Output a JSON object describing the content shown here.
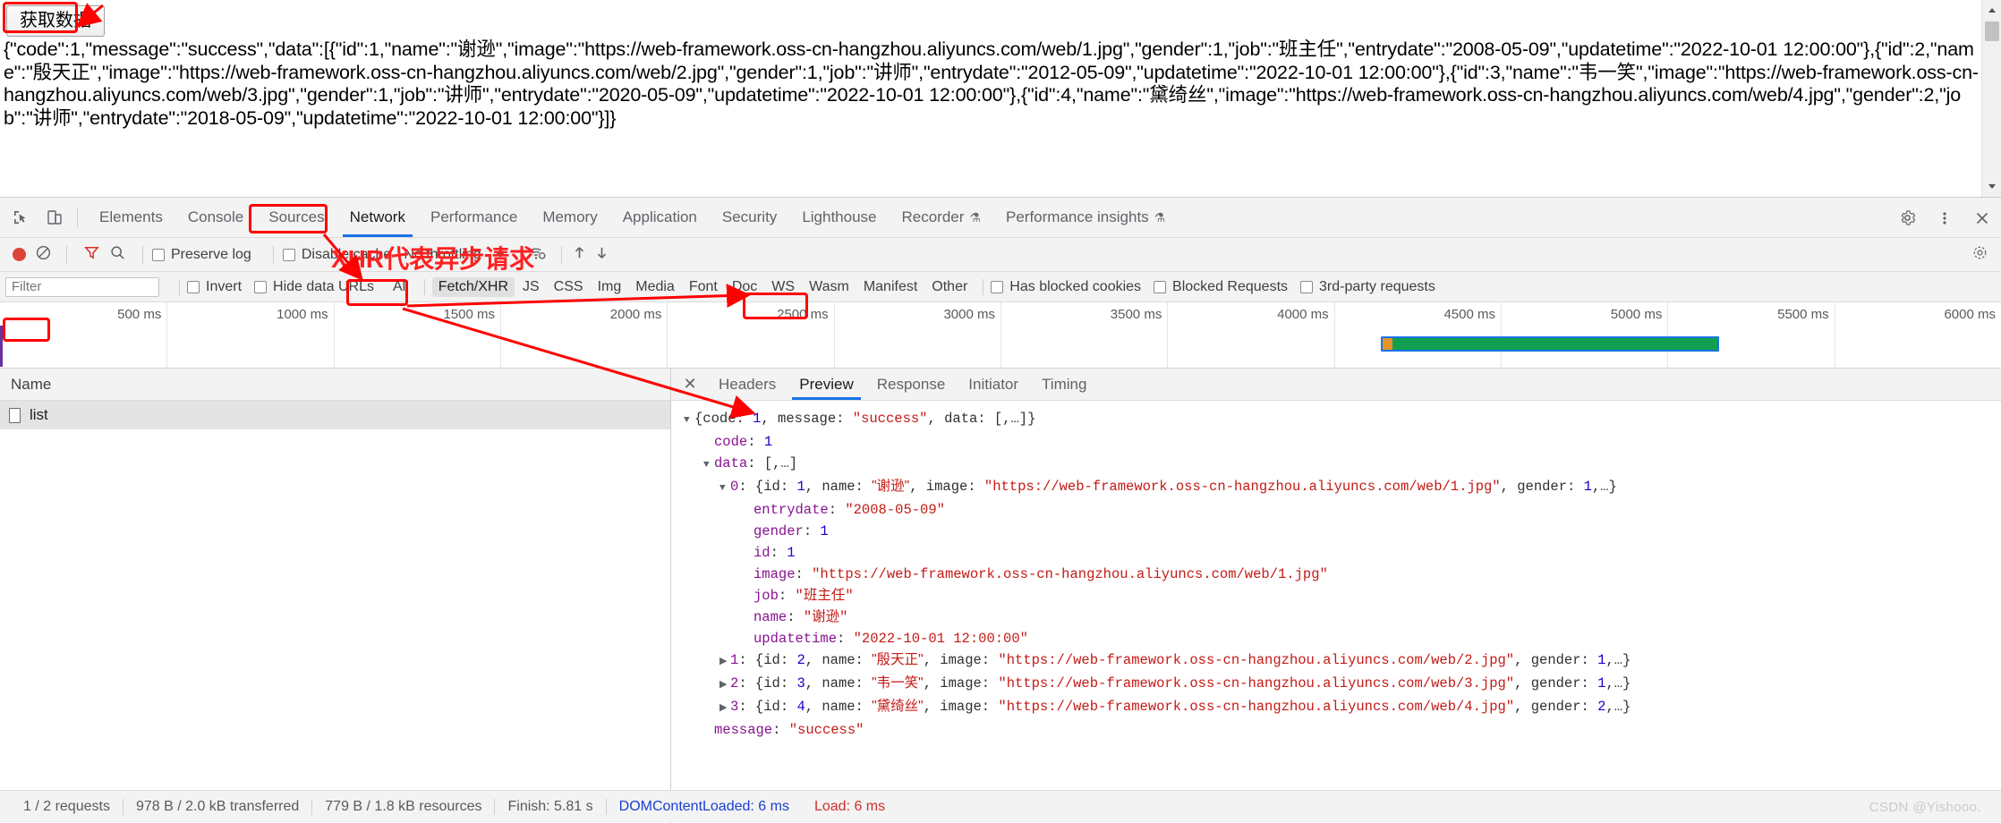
{
  "page": {
    "button_label": "获取数据",
    "json_dump": "{\"code\":1,\"message\":\"success\",\"data\":[{\"id\":1,\"name\":\"谢逊\",\"image\":\"https://web-framework.oss-cn-hangzhou.aliyuncs.com/web/1.jpg\",\"gender\":1,\"job\":\"班主任\",\"entrydate\":\"2008-05-09\",\"updatetime\":\"2022-10-01 12:00:00\"},{\"id\":2,\"name\":\"殷天正\",\"image\":\"https://web-framework.oss-cn-hangzhou.aliyuncs.com/web/2.jpg\",\"gender\":1,\"job\":\"讲师\",\"entrydate\":\"2012-05-09\",\"updatetime\":\"2022-10-01 12:00:00\"},{\"id\":3,\"name\":\"韦一笑\",\"image\":\"https://web-framework.oss-cn-hangzhou.aliyuncs.com/web/3.jpg\",\"gender\":1,\"job\":\"讲师\",\"entrydate\":\"2020-05-09\",\"updatetime\":\"2022-10-01 12:00:00\"},{\"id\":4,\"name\":\"黛绮丝\",\"image\":\"https://web-framework.oss-cn-hangzhou.aliyuncs.com/web/4.jpg\",\"gender\":2,\"job\":\"讲师\",\"entrydate\":\"2018-05-09\",\"updatetime\":\"2022-10-01 12:00:00\"}]}"
  },
  "devtools": {
    "tabs": [
      {
        "label": "Elements",
        "active": false,
        "flask": false
      },
      {
        "label": "Console",
        "active": false,
        "flask": false
      },
      {
        "label": "Sources",
        "active": false,
        "flask": false
      },
      {
        "label": "Network",
        "active": true,
        "flask": false
      },
      {
        "label": "Performance",
        "active": false,
        "flask": false
      },
      {
        "label": "Memory",
        "active": false,
        "flask": false
      },
      {
        "label": "Application",
        "active": false,
        "flask": false
      },
      {
        "label": "Security",
        "active": false,
        "flask": false
      },
      {
        "label": "Lighthouse",
        "active": false,
        "flask": false
      },
      {
        "label": "Recorder",
        "active": false,
        "flask": true
      },
      {
        "label": "Performance insights",
        "active": false,
        "flask": true
      }
    ],
    "icons": {
      "inspect": "inspect-element-icon",
      "device": "device-toolbar-icon",
      "settings": "gear-icon",
      "more": "kebab-menu-icon",
      "close": "close-icon",
      "record": "record-icon",
      "clear": "clear-icon",
      "filter": "filter-icon",
      "search": "search-icon",
      "wifi": "network-conditions-icon",
      "import": "import-har-icon",
      "export": "export-har-icon"
    },
    "controls": {
      "preserve_log": "Preserve log",
      "disable_cache": "Disable cache",
      "throttling": "No throttling"
    },
    "filterbar": {
      "filter_placeholder": "Filter",
      "filter_value": "",
      "invert": "Invert",
      "hide_data_urls": "Hide data URLs",
      "types": [
        {
          "label": "All",
          "active": false
        },
        {
          "label": "Fetch/XHR",
          "active": true
        },
        {
          "label": "JS",
          "active": false
        },
        {
          "label": "CSS",
          "active": false
        },
        {
          "label": "Img",
          "active": false
        },
        {
          "label": "Media",
          "active": false
        },
        {
          "label": "Font",
          "active": false
        },
        {
          "label": "Doc",
          "active": false
        },
        {
          "label": "WS",
          "active": false
        },
        {
          "label": "Wasm",
          "active": false
        },
        {
          "label": "Manifest",
          "active": false
        },
        {
          "label": "Other",
          "active": false
        }
      ],
      "has_blocked_cookies": "Has blocked cookies",
      "blocked_requests": "Blocked Requests",
      "third_party_requests": "3rd-party requests"
    },
    "overview": {
      "ticks": [
        "500 ms",
        "1000 ms",
        "1500 ms",
        "2000 ms",
        "2500 ms",
        "3000 ms",
        "3500 ms",
        "4000 ms",
        "4500 ms",
        "5000 ms",
        "5500 ms",
        "6000 ms"
      ]
    },
    "requests": {
      "column_name": "Name",
      "rows": [
        {
          "name": "list"
        }
      ]
    },
    "detail_tabs": [
      {
        "label": "Headers",
        "active": false
      },
      {
        "label": "Preview",
        "active": true
      },
      {
        "label": "Response",
        "active": false
      },
      {
        "label": "Initiator",
        "active": false
      },
      {
        "label": "Timing",
        "active": false
      }
    ],
    "preview_tree": [
      {
        "indent": 0,
        "tri": "▼",
        "text": "{code: 1, message: \"success\", data: [,…]}",
        "style": "plain"
      },
      {
        "indent": 1,
        "tri": "",
        "key": "code",
        "val": "1",
        "valtype": "num"
      },
      {
        "indent": 0,
        "tri": "▼",
        "key": "data",
        "val": "[,…]",
        "valtype": "plain",
        "indentpx": 22
      },
      {
        "indent": 0,
        "tri": "▼",
        "key": "0",
        "val": "{id: 1, name: \"谢逊\", image: \"https://web-framework.oss-cn-hangzhou.aliyuncs.com/web/1.jpg\", gender: 1,…}",
        "valtype": "object",
        "indentpx": 40
      },
      {
        "indent": 0,
        "tri": "",
        "key": "entrydate",
        "val": "\"2008-05-09\"",
        "valtype": "str",
        "indentpx": 66
      },
      {
        "indent": 0,
        "tri": "",
        "key": "gender",
        "val": "1",
        "valtype": "num",
        "indentpx": 66
      },
      {
        "indent": 0,
        "tri": "",
        "key": "id",
        "val": "1",
        "valtype": "num",
        "indentpx": 66
      },
      {
        "indent": 0,
        "tri": "",
        "key": "image",
        "val": "\"https://web-framework.oss-cn-hangzhou.aliyuncs.com/web/1.jpg\"",
        "valtype": "str",
        "indentpx": 66
      },
      {
        "indent": 0,
        "tri": "",
        "key": "job",
        "val": "\"班主任\"",
        "valtype": "str",
        "indentpx": 66
      },
      {
        "indent": 0,
        "tri": "",
        "key": "name",
        "val": "\"谢逊\"",
        "valtype": "str",
        "indentpx": 66
      },
      {
        "indent": 0,
        "tri": "",
        "key": "updatetime",
        "val": "\"2022-10-01 12:00:00\"",
        "valtype": "str",
        "indentpx": 66
      },
      {
        "indent": 0,
        "tri": "▶",
        "key": "1",
        "val": "{id: 2, name: \"殷天正\", image: \"https://web-framework.oss-cn-hangzhou.aliyuncs.com/web/2.jpg\", gender: 1,…}",
        "valtype": "object",
        "indentpx": 40
      },
      {
        "indent": 0,
        "tri": "▶",
        "key": "2",
        "val": "{id: 3, name: \"韦一笑\", image: \"https://web-framework.oss-cn-hangzhou.aliyuncs.com/web/3.jpg\", gender: 1,…}",
        "valtype": "object",
        "indentpx": 40
      },
      {
        "indent": 0,
        "tri": "▶",
        "key": "3",
        "val": "{id: 4, name: \"黛绮丝\", image: \"https://web-framework.oss-cn-hangzhou.aliyuncs.com/web/4.jpg\", gender: 2,…}",
        "valtype": "object",
        "indentpx": 40
      },
      {
        "indent": 0,
        "tri": "",
        "key": "message",
        "val": "\"success\"",
        "valtype": "str",
        "indentpx": 22
      }
    ],
    "status": {
      "requests": "1 / 2 requests",
      "transferred": "978 B / 2.0 kB transferred",
      "resources": "779 B / 1.8 kB resources",
      "finish": "Finish: 5.81 s",
      "dom_content_loaded": "DOMContentLoaded: 6 ms",
      "load": "Load: 6 ms"
    },
    "watermark": "CSDN @Yishooo."
  },
  "annotations": {
    "xhr_note": "XHR代表异步请求",
    "color": "#ff0000"
  }
}
